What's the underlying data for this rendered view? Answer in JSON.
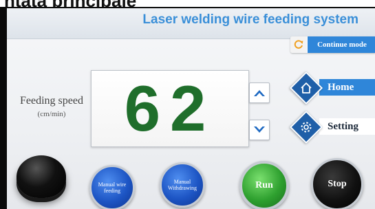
{
  "caption": {
    "text": "ntata principale"
  },
  "header": {
    "title": "Laser welding wire feeding system"
  },
  "mode": {
    "icon": "refresh-icon",
    "label": "Continue mode"
  },
  "speed": {
    "label": "Feeding speed",
    "unit": "(cm/min)",
    "value": "62"
  },
  "controls": {
    "up_icon": "chevron-up-icon",
    "down_icon": "chevron-down-icon"
  },
  "nav": {
    "home": {
      "icon": "home-icon",
      "label": "Home"
    },
    "setting": {
      "icon": "gear-icon",
      "label": "Setting"
    }
  },
  "buttons": {
    "manual_feed_line1": "Manual wire",
    "manual_feed_line2": "feeding",
    "manual_withdraw_line1": "Manual",
    "manual_withdraw_line2": "Withdrawing",
    "run": "Run",
    "stop": "Stop"
  },
  "colors": {
    "accent": "#2f86d9",
    "speed_digits": "#1f6e2b",
    "run": "#2ea02f",
    "stop": "#111111",
    "manual_buttons": "#1d55c4"
  }
}
